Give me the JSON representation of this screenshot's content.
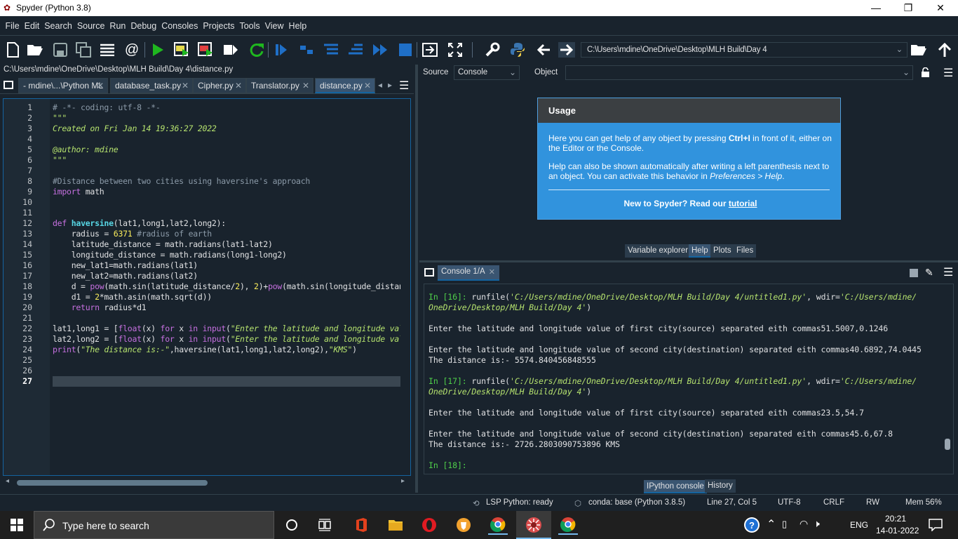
{
  "window": {
    "title": "Spyder (Python 3.8)",
    "minimize": "—",
    "restore": "❐",
    "close": "✕"
  },
  "menu": [
    "File",
    "Edit",
    "Search",
    "Source",
    "Run",
    "Debug",
    "Consoles",
    "Projects",
    "Tools",
    "View",
    "Help"
  ],
  "toolbar": {
    "path": "C:\\Users\\mdine\\OneDrive\\Desktop\\MLH Build\\Day 4"
  },
  "editor": {
    "file_path": "C:\\Users\\mdine\\OneDrive\\Desktop\\MLH Build\\Day 4\\distance.py",
    "tabs": [
      {
        "label": "- mdine\\...\\Python ML"
      },
      {
        "label": "database_task.py"
      },
      {
        "label": "Cipher.py"
      },
      {
        "label": "Translator.py"
      },
      {
        "label": "distance.py"
      }
    ],
    "line_numbers": [
      "1",
      "2",
      "3",
      "4",
      "5",
      "6",
      "7",
      "8",
      "9",
      "10",
      "11",
      "12",
      "13",
      "14",
      "15",
      "16",
      "17",
      "18",
      "19",
      "20",
      "21",
      "22",
      "23",
      "24",
      "25",
      "26",
      "27"
    ],
    "current_line": "27"
  },
  "help_pane": {
    "source_label": "Source",
    "source_value": "Console",
    "object_label": "Object",
    "usage_title": "Usage",
    "usage_p1_a": "Here you can get help of any object by pressing ",
    "usage_p1_b": "Ctrl+I",
    "usage_p1_c": " in front of it, either on the Editor or the Console.",
    "usage_p2_a": "Help can also be shown automatically after writing a left parenthesis next to an object. You can activate this behavior in ",
    "usage_p2_b": "Preferences > Help",
    "usage_p2_c": ".",
    "usage_footer": "New to Spyder? Read our ",
    "usage_link": "tutorial",
    "tabs": [
      "Variable explorer",
      "Help",
      "Plots",
      "Files"
    ]
  },
  "console": {
    "tab": "Console 1/A",
    "bottom_tabs": [
      "IPython console",
      "History"
    ]
  },
  "status": {
    "lsp": "LSP Python: ready",
    "conda": "conda: base (Python 3.8.5)",
    "position": "Line 27, Col 5",
    "encoding": "UTF-8",
    "eol": "CRLF",
    "rw": "RW",
    "mem": "Mem 56%"
  },
  "taskbar": {
    "search_placeholder": "Type here to search",
    "lang": "ENG",
    "time": "20:21",
    "date": "14-01-2022"
  },
  "colors": {
    "accent": "#1464a0",
    "background": "#19232d",
    "help_blue": "#3193dd"
  }
}
